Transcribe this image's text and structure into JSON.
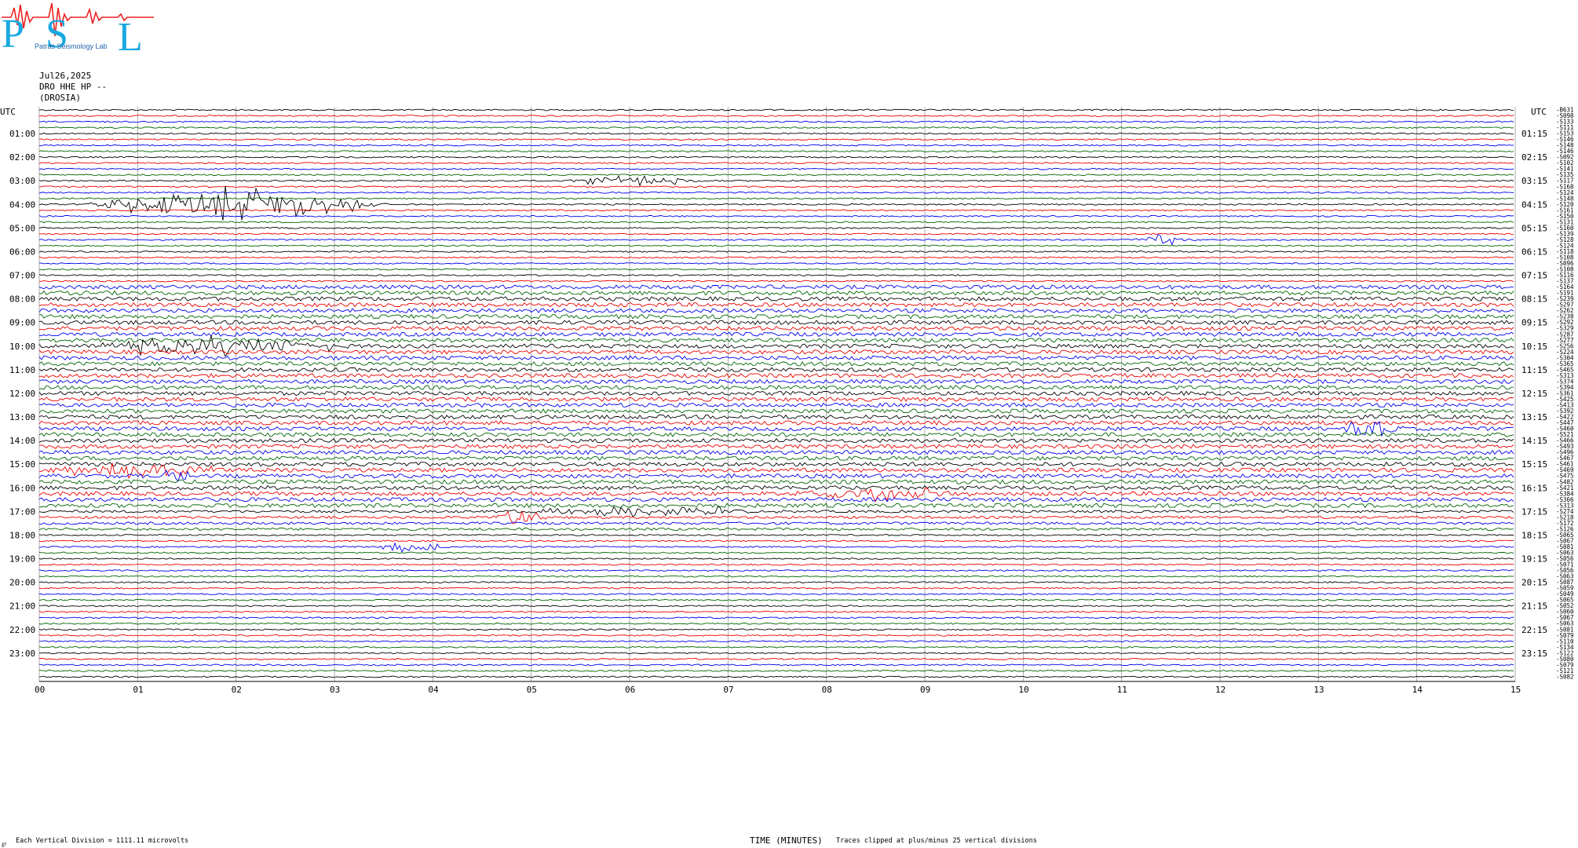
{
  "logo": {
    "letters": [
      "P",
      "S",
      "L"
    ],
    "sub_text": "Patras Seismology Lab",
    "wave_color": "#ee2222",
    "letter_color": "#19a8e0"
  },
  "header": {
    "date": "Jul26,2025",
    "station": "DRO HHE HP --",
    "station_name": "(DROSIA)"
  },
  "footer": {
    "scale_note": "Each Vertical Division = 1111.11 microvolts",
    "clip_note": "Traces clipped at plus/minus 25 vertical divisions",
    "corner_mark": "℘"
  },
  "chart_data": {
    "type": "line",
    "title": "",
    "xlabel": "TIME (MINUTES)",
    "ylabel_left": "UTC",
    "ylabel_right": "UTC",
    "x_ticks": [
      "00",
      "01",
      "02",
      "03",
      "04",
      "05",
      "06",
      "07",
      "08",
      "09",
      "10",
      "11",
      "12",
      "13",
      "14",
      "15"
    ],
    "xlim": [
      0,
      15
    ],
    "grid": true,
    "trace_colors": [
      "#000000",
      "#ee0000",
      "#0000ee",
      "#006600"
    ],
    "left_hour_labels": [
      "01:00",
      "02:00",
      "03:00",
      "04:00",
      "05:00",
      "06:00",
      "07:00",
      "08:00",
      "09:00",
      "10:00",
      "11:00",
      "12:00",
      "13:00",
      "14:00",
      "15:00",
      "16:00",
      "17:00",
      "18:00",
      "19:00",
      "20:00",
      "21:00",
      "22:00",
      "23:00"
    ],
    "right_hour_labels": [
      "01:15",
      "02:15",
      "03:15",
      "04:15",
      "05:15",
      "06:15",
      "07:15",
      "08:15",
      "09:15",
      "10:15",
      "11:15",
      "12:15",
      "13:15",
      "14:15",
      "15:15",
      "16:15",
      "17:15",
      "18:15",
      "19:15",
      "20:15",
      "21:15",
      "22:15",
      "23:15"
    ],
    "trace_rms_labels": [
      "-B631",
      "-S098",
      "-S133",
      "-S111",
      "-S153",
      "-S146",
      "-S148",
      "-S146",
      "-S092",
      "-S102",
      "-S141",
      "-S135",
      "-S117",
      "-S168",
      "-S124",
      "-S148",
      "-S120",
      "-S161",
      "-S150",
      "-S131",
      "-S160",
      "-S139",
      "-S128",
      "-S124",
      "-S118",
      "-S108",
      "-S096",
      "-S108",
      "-S116",
      "-S137",
      "-S164",
      "-S191",
      "-S239",
      "-S297",
      "-S262",
      "-S238",
      "-S292",
      "-S329",
      "-S287",
      "-S277",
      "-S256",
      "-S224",
      "-S304",
      "-S365",
      "-S465",
      "-S313",
      "-S374",
      "-S394",
      "-S361",
      "-S425",
      "-S413",
      "-S392",
      "-S422",
      "-S447",
      "-S460",
      "-S521",
      "-S466",
      "-S493",
      "-S496",
      "-S467",
      "-S461",
      "-S469",
      "-S475",
      "-S482",
      "-S421",
      "-S384",
      "-S366",
      "-S313",
      "-S274",
      "-S218",
      "-S172",
      "-S126",
      "-S065",
      "-S067",
      "-S081",
      "-S063",
      "-S056",
      "-S071",
      "-S056",
      "-S063",
      "-S087",
      "-S059",
      "-S049",
      "-S065",
      "-S052",
      "-S060",
      "-S067",
      "-S063",
      "-S081",
      "-S079",
      "-S110",
      "-S134",
      "-S122",
      "-S080",
      "-S079",
      "-S121",
      "-S082"
    ],
    "trace_count": 97,
    "events": [
      {
        "trace": 16,
        "start_min": 0.4,
        "end_min": 3.6,
        "amp": 3.0,
        "color": "#ee0000"
      },
      {
        "trace": 12,
        "start_min": 5.2,
        "end_min": 6.8,
        "amp": 0.8,
        "color": "#000000"
      },
      {
        "trace": 22,
        "start_min": 11.0,
        "end_min": 11.8,
        "amp": 1.0,
        "color": "#0000ee"
      },
      {
        "trace": 40,
        "start_min": 0.4,
        "end_min": 3.2,
        "amp": 1.8,
        "color": "#0000ee"
      },
      {
        "trace": 54,
        "start_min": 13.2,
        "end_min": 13.9,
        "amp": 2.0,
        "color": "#0000ee"
      },
      {
        "trace": 61,
        "start_min": 0.0,
        "end_min": 2.0,
        "amp": 1.2,
        "color": "#000000"
      },
      {
        "trace": 62,
        "start_min": 1.2,
        "end_min": 1.6,
        "amp": 1.6,
        "color": "#006600"
      },
      {
        "trace": 65,
        "start_min": 7.4,
        "end_min": 9.6,
        "amp": 1.1,
        "color": "#000000"
      },
      {
        "trace": 68,
        "start_min": 4.6,
        "end_min": 7.6,
        "amp": 1.0,
        "color": "#0000ee"
      },
      {
        "trace": 69,
        "start_min": 4.6,
        "end_min": 5.2,
        "amp": 1.5,
        "color": "#000000"
      },
      {
        "trace": 74,
        "start_min": 3.4,
        "end_min": 4.2,
        "amp": 1.0,
        "color": "#0000ee"
      },
      {
        "trace": 97,
        "start_min": 4.1,
        "end_min": 5.8,
        "amp": 1.0,
        "color": "#006600"
      },
      {
        "trace": 97,
        "start_min": 10.5,
        "end_min": 10.9,
        "amp": 1.2,
        "color": "#006600"
      }
    ]
  }
}
